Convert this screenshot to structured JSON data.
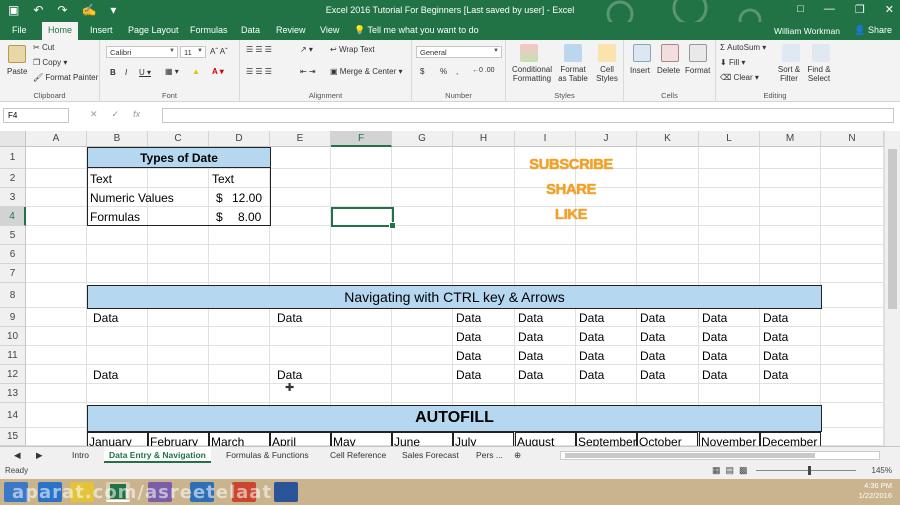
{
  "window": {
    "title": "Excel 2016 Tutorial For Beginners [Last saved by user] - Excel",
    "user": "William Workman",
    "share": "Share",
    "tell_me": "Tell me what you want to do"
  },
  "tabs": [
    "File",
    "Home",
    "Insert",
    "Page Layout",
    "Formulas",
    "Data",
    "Review",
    "View"
  ],
  "ribbon": {
    "clipboard": {
      "paste": "Paste",
      "cut": "Cut",
      "copy": "Copy",
      "format_painter": "Format Painter",
      "label": "Clipboard"
    },
    "font": {
      "name": "Calibri",
      "size": "11",
      "label": "Font"
    },
    "alignment": {
      "wrap": "Wrap Text",
      "merge": "Merge & Center",
      "label": "Alignment"
    },
    "number": {
      "format": "General",
      "label": "Number",
      "dollar": "$",
      "percent": "%",
      "comma": ","
    },
    "styles": {
      "conditional": "Conditional Formatting",
      "format_table": "Format as Table",
      "cell_styles": "Cell Styles",
      "label": "Styles"
    },
    "cells": {
      "insert": "Insert",
      "delete": "Delete",
      "format": "Format",
      "label": "Cells"
    },
    "editing": {
      "autosum": "AutoSum",
      "fill": "Fill",
      "clear": "Clear",
      "sort": "Sort & Filter",
      "find": "Find & Select",
      "label": "Editing"
    }
  },
  "formula_bar": {
    "name_box": "F4",
    "fx": "fx",
    "content": ""
  },
  "columns": [
    "A",
    "B",
    "C",
    "D",
    "E",
    "F",
    "G",
    "H",
    "I",
    "J",
    "K",
    "L",
    "M",
    "N"
  ],
  "rows": [
    "1",
    "2",
    "3",
    "4",
    "5",
    "6",
    "7",
    "8",
    "9",
    "10",
    "11",
    "12",
    "13",
    "14",
    "15"
  ],
  "cells": {
    "types_title": "Types of Date",
    "b2": "Text",
    "d2": "Text",
    "b3": "Numeric Values",
    "d3_sym": "$",
    "d3_val": "12.00",
    "b4": "Formulas",
    "d4_sym": "$",
    "d4_val": "8.00",
    "nav_title": "Navigating with CTRL key & Arrows",
    "data": "Data",
    "autofill_title": "AUTOFILL",
    "months": [
      "January",
      "February",
      "March",
      "April",
      "May",
      "June",
      "July",
      "August",
      "September",
      "October",
      "November",
      "December"
    ]
  },
  "promo": {
    "line1": "SUBSCRIBE",
    "line2": "SHARE",
    "line3": "LIKE"
  },
  "sheets": [
    "Intro",
    "Data Entry & Navigation",
    "Formulas & Functions",
    "Cell Reference",
    "Sales Forecast",
    "Pers ..."
  ],
  "status": {
    "ready": "Ready",
    "zoom": "145%"
  },
  "taskbar": {
    "time": "4:36 PM",
    "date": "1/22/2016"
  },
  "watermark": "aparat.com/asreetelaat",
  "colors": {
    "excel_green": "#217346",
    "band_blue": "#b6d7f0",
    "promo_orange": "#f4a020"
  }
}
